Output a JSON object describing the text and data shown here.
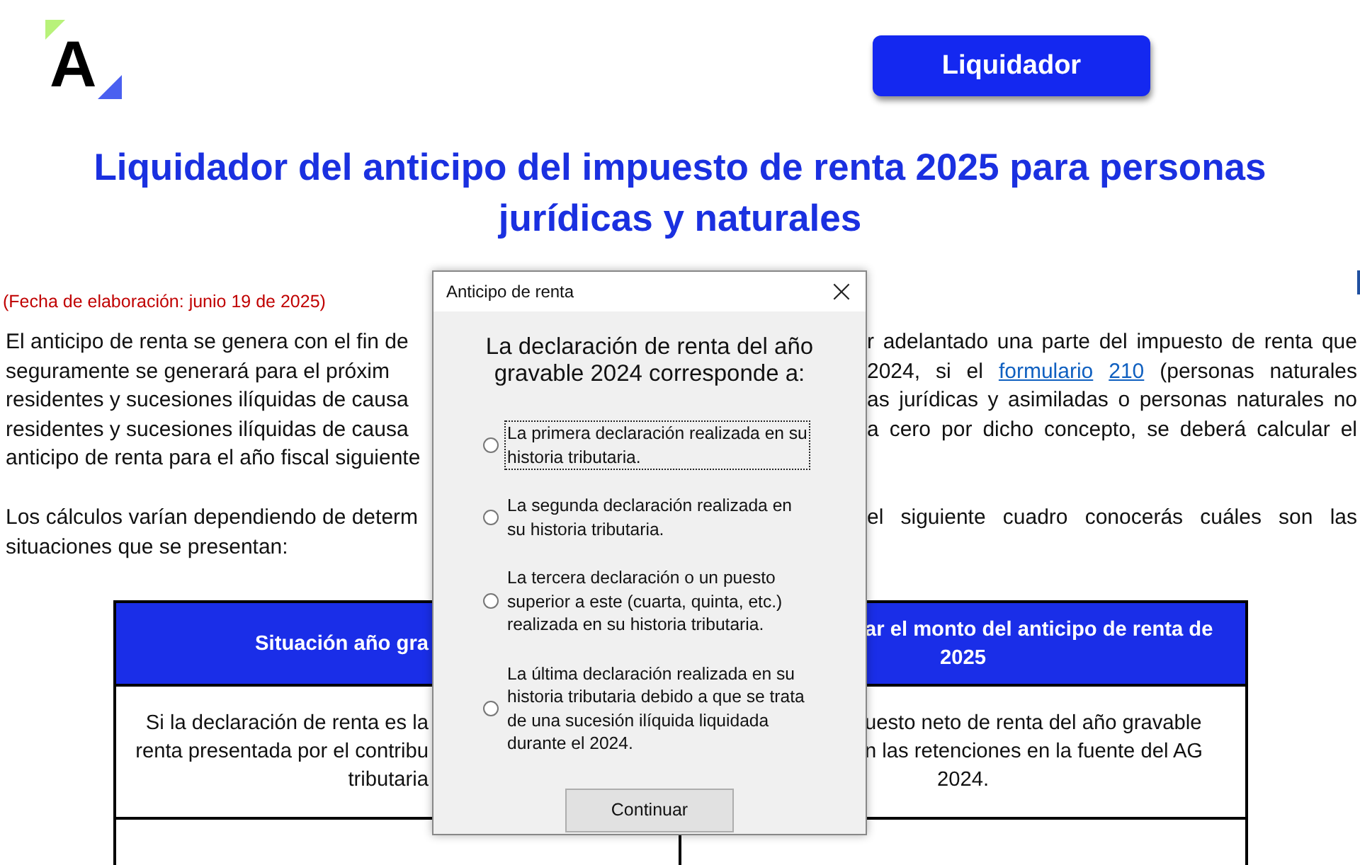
{
  "logo": {
    "letter": "A"
  },
  "header_button": "Liquidador",
  "title": [
    "Liquidador del anticipo del impuesto de renta 2025 para personas",
    "jurídicas y naturales"
  ],
  "date_note": "(Fecha de elaboración: junio 19 de 2025)",
  "paragraphs": [
    {
      "lines": [
        {
          "left": "El anticipo de renta se genera con el fin de",
          "right": [
            {
              "kind": "text",
              "text": "r adelantado una parte del impuesto de renta que"
            }
          ]
        },
        {
          "left": "seguramente se generará para el próxim",
          "right": [
            {
              "kind": "text",
              "text": "2024, si el "
            },
            {
              "kind": "link",
              "text": "formulario"
            },
            {
              "kind": "link",
              "text": "210"
            },
            {
              "kind": "text",
              "text": " (personas naturales"
            }
          ]
        },
        {
          "left": "residentes y sucesiones ilíquidas de causa",
          "right": [
            {
              "kind": "text",
              "text": "as jurídicas y asimiladas o personas naturales no"
            }
          ]
        },
        {
          "left": "residentes y sucesiones ilíquidas de causa",
          "right": [
            {
              "kind": "text",
              "text": "a cero por dicho concepto, se deberá calcular el"
            }
          ]
        },
        {
          "left": "anticipo de renta para el año fiscal siguiente"
        }
      ]
    },
    {
      "lines": [
        {
          "left": "Los cálculos varían dependiendo de determ",
          "right": [
            {
              "kind": "text",
              "text": "el siguiente cuadro conocerás cuáles son las"
            }
          ]
        },
        {
          "left": "situaciones que se presentan:"
        }
      ]
    }
  ],
  "table": {
    "header": {
      "left": [
        "Situación año gra"
      ],
      "right_cut": [
        "ar el monto del anticipo de renta de"
      ],
      "right_full": [
        "2025"
      ]
    },
    "rows": [
      {
        "left": [
          "Si la declaración de renta es la",
          "renta presentada por el contribu",
          "tributaria"
        ],
        "right_cut": [
          "uesto neto de renta del año gravable",
          "n las retenciones en la fuente del AG"
        ],
        "right_full": [
          "2024."
        ]
      }
    ]
  },
  "dialog": {
    "title": "Anticipo de renta",
    "close": "×",
    "question": "La declaración de renta del año gravable 2024 corresponde a:",
    "options": [
      {
        "label": "La primera declaración realizada en su historia tributaria.",
        "selected": false,
        "focused": true
      },
      {
        "label": "La segunda declaración realizada en su historia tributaria.",
        "selected": false,
        "focused": false
      },
      {
        "label": "La tercera declaración o un puesto superior a este (cuarta, quinta, etc.) realizada en su historia tributaria.",
        "selected": false,
        "focused": false
      },
      {
        "label": "La última declaración realizada en su historia tributaria debido a que se trata de una sucesión ilíquida liquidada durante el 2024.",
        "selected": false,
        "focused": false
      }
    ],
    "button": "Continuar"
  }
}
